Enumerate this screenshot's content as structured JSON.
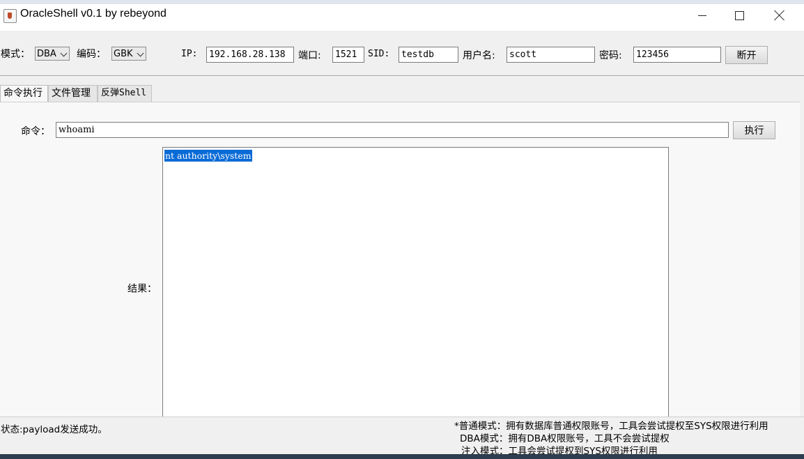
{
  "window": {
    "title": "OracleShell v0.1  by rebeyond"
  },
  "connection": {
    "mode_label": "模式：",
    "mode_value": "DBA",
    "encoding_label": "编码：",
    "encoding_value": "GBK",
    "ip_label": "IP:",
    "ip_value": "192.168.28.138",
    "port_label": "端口:",
    "port_value": "1521",
    "sid_label": "SID:",
    "sid_value": "testdb",
    "user_label": "用户名:",
    "user_value": "scott",
    "password_label": "密码:",
    "password_value": "123456",
    "disconnect_label": "断开"
  },
  "tabs": [
    {
      "label": "命令执行",
      "active": true
    },
    {
      "label": "文件管理",
      "active": false
    },
    {
      "label": "反弹Shell",
      "active": false
    }
  ],
  "command": {
    "label": "命令：",
    "value": "whoami",
    "execute_label": "执行",
    "result_label": "结果：",
    "result_text": "nt authority\\system"
  },
  "status": {
    "text": "状态:payload发送成功。",
    "notes": [
      "*普通模式：拥有数据库普通权限账号，工具会尝试提权至SYS权限进行利用",
      "DBA模式：拥有DBA权限账号，工具不会尝试提权",
      "注入模式：工具会尝试提权到SYS权限进行利用"
    ]
  },
  "colors": {
    "selection": "#0a6bd6",
    "window_bg": "#f0f0f0"
  }
}
